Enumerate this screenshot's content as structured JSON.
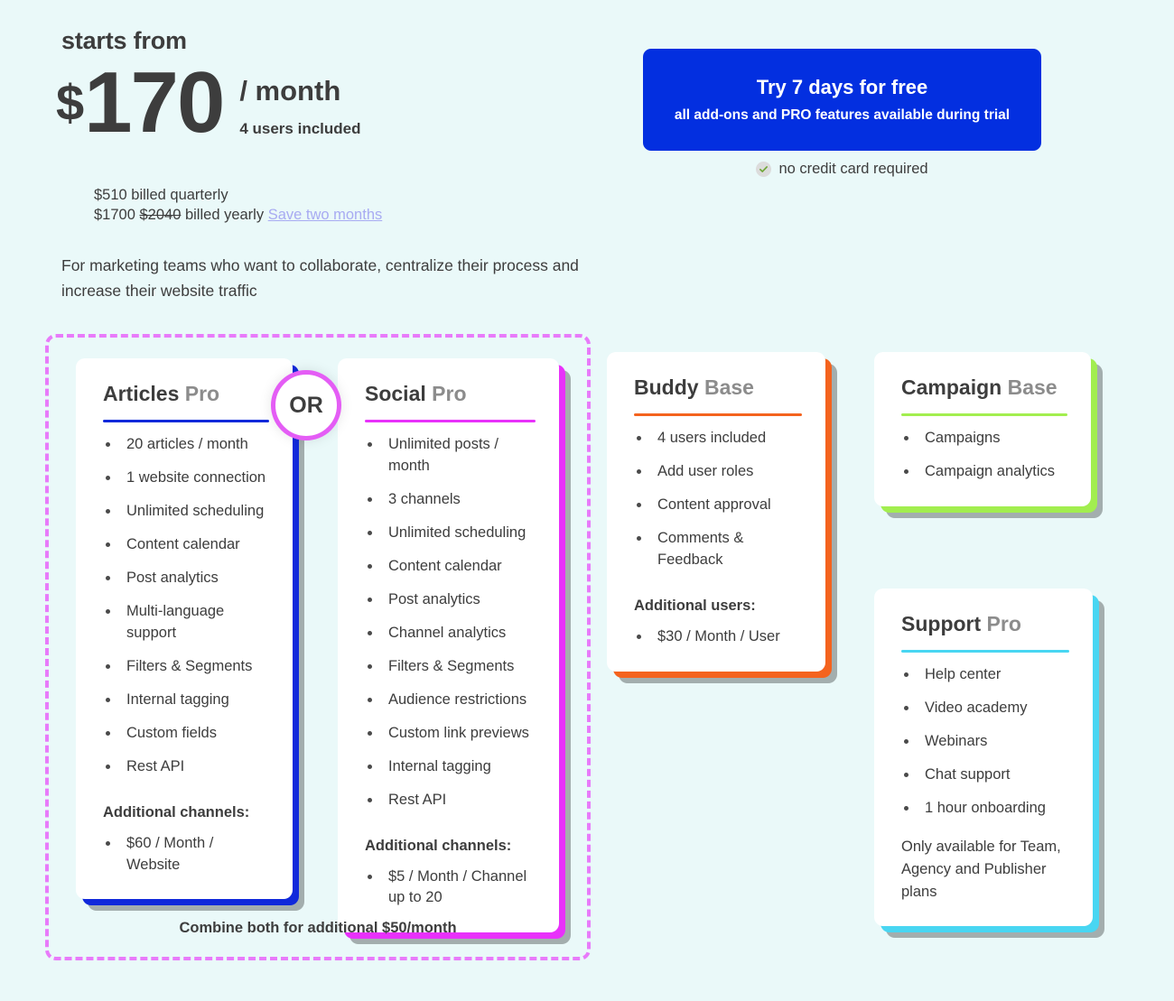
{
  "pricing": {
    "starts_from_label": "starts from",
    "currency": "$",
    "amount": "170",
    "per_period": "/ month",
    "users_included": "4 users included",
    "billing_quarterly": "$510 billed quarterly",
    "billing_yearly_price": "$1700",
    "billing_yearly_old_price": "$2040",
    "billing_yearly_suffix": "billed yearly",
    "save_link": "Save two months",
    "tagline": "For marketing teams who want to collaborate, centralize their process and increase their website traffic"
  },
  "cta": {
    "title": "Try 7 days for free",
    "subtitle": "all add-ons and PRO features available during trial",
    "no_credit_card": "no credit card required",
    "check_icon": "check-circle-icon",
    "button_color": "#032fe0"
  },
  "combo": {
    "or_label": "OR",
    "note": "Combine both for additional $50/month",
    "border_color": "#e87bfa"
  },
  "cards": {
    "articles": {
      "name": "Articles",
      "tier": "Pro",
      "accent": "#1029db",
      "features": [
        "20 articles / month",
        "1 website connection",
        "Unlimited scheduling",
        "Content calendar",
        "Post analytics",
        "Multi-language support",
        "Filters & Segments",
        "Internal tagging",
        "Custom fields",
        "Rest API"
      ],
      "sub_head": "Additional channels:",
      "extra": [
        "$60 / Month / Website"
      ]
    },
    "social": {
      "name": "Social",
      "tier": "Pro",
      "accent": "#e831fa",
      "features": [
        "Unlimited posts / month",
        "3 channels",
        "Unlimited scheduling",
        "Content calendar",
        "Post analytics",
        "Channel analytics",
        "Filters & Segments",
        "Audience restrictions",
        "Custom link previews",
        "Internal tagging",
        "Rest API"
      ],
      "sub_head": "Additional channels:",
      "extra": [
        "$5 / Month / Channel up to 20"
      ]
    },
    "buddy": {
      "name": "Buddy",
      "tier": "Base",
      "accent": "#f4631e",
      "features": [
        "4 users included",
        "Add user roles",
        "Content approval",
        "Comments & Feedback"
      ],
      "sub_head": "Additional users:",
      "extra": [
        "$30 / Month / User"
      ]
    },
    "campaign": {
      "name": "Campaign",
      "tier": "Base",
      "accent": "#a2ee4f",
      "features": [
        "Campaigns",
        "Campaign analytics"
      ]
    },
    "support": {
      "name": "Support",
      "tier": "Pro",
      "accent": "#48d6f2",
      "features": [
        "Help center",
        "Video academy",
        "Webinars",
        "Chat support",
        "1 hour onboarding"
      ],
      "note": "Only available for Team, Agency and Publisher plans"
    }
  }
}
